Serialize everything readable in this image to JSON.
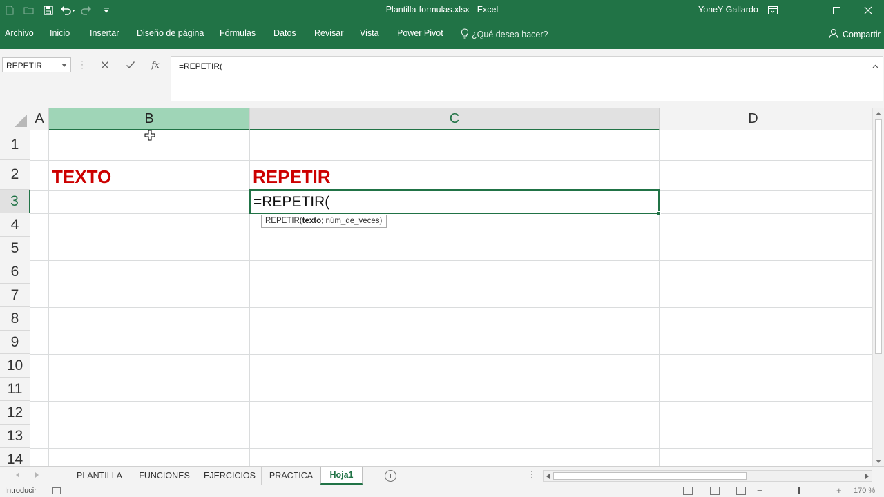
{
  "window": {
    "title": "Plantilla-formulas.xlsx  -  Excel",
    "user": "YoneY Gallardo"
  },
  "ribbon": {
    "tabs": [
      "Archivo",
      "Inicio",
      "Insertar",
      "Diseño de página",
      "Fórmulas",
      "Datos",
      "Revisar",
      "Vista",
      "Power Pivot"
    ],
    "tell_me": "¿Qué desea hacer?",
    "share": "Compartir"
  },
  "formula_bar": {
    "name_box": "REPETIR",
    "fx": "fx",
    "formula": "=REPETIR("
  },
  "columns": [
    "A",
    "B",
    "C",
    "D"
  ],
  "rows": [
    "1",
    "2",
    "3",
    "4",
    "5",
    "6",
    "7",
    "8",
    "9",
    "10",
    "11",
    "12",
    "13",
    "14"
  ],
  "cells": {
    "B2": "TEXTO",
    "C2": "REPETIR",
    "C3_editing": "=REPETIR("
  },
  "tooltip": {
    "func": "REPETIR(",
    "arg_current": "texto",
    "rest": "; núm_de_veces)"
  },
  "sheets": {
    "tabs": [
      "PLANTILLA",
      "FUNCIONES",
      "EJERCICIOS",
      "PRACTICA",
      "Hoja1"
    ],
    "active": "Hoja1"
  },
  "status": {
    "mode": "Introducir",
    "zoom": "170 %"
  },
  "colors": {
    "brand_green": "#217346",
    "heading_red": "#cc0000"
  }
}
